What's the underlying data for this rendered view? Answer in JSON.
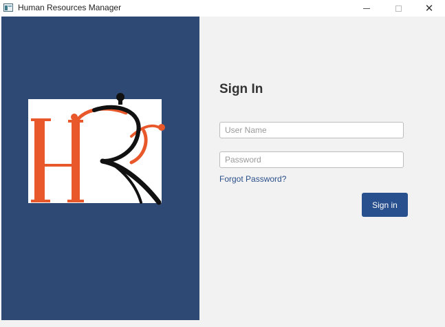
{
  "window": {
    "title": "Human Resources Manager",
    "minimize_icon": "minimize-icon",
    "maximize_icon": "maximize-icon",
    "close_icon": "close-icon",
    "close_glyph": "✕"
  },
  "branding": {
    "logo": "hr-logo",
    "logo_text": "HR",
    "panel_color": "#2e4a74",
    "logo_orange": "#e8582b",
    "logo_black": "#111111"
  },
  "login": {
    "heading": "Sign In",
    "username_placeholder": "User Name",
    "username_value": "",
    "password_placeholder": "Password",
    "password_value": "",
    "forgot_password": "Forgot Password?",
    "signin_button": "Sign in",
    "accent": "#28508e"
  }
}
